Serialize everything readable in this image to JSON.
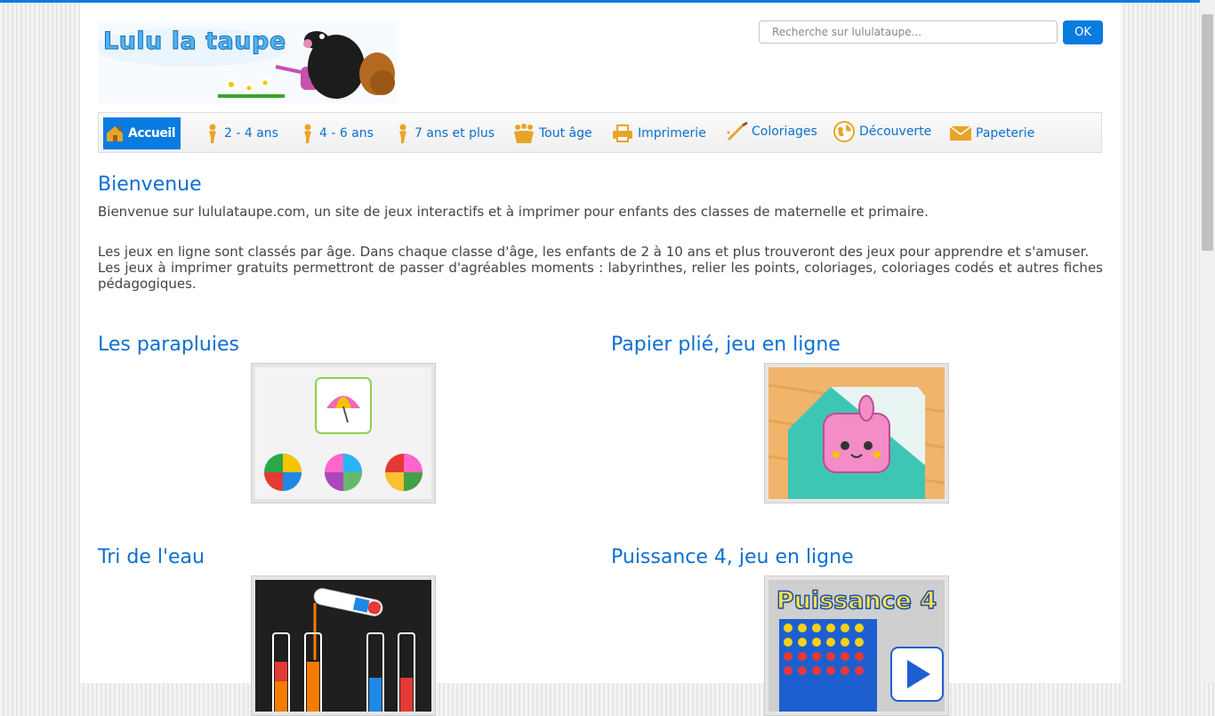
{
  "logo": {
    "text": "Lulu la taupe"
  },
  "search": {
    "placeholder": "Recherche sur lululataupe...",
    "button_label": "OK"
  },
  "nav": {
    "items": [
      {
        "label": "Accueil",
        "icon": "house-icon"
      },
      {
        "label": "2 - 4 ans",
        "icon": "child-icon"
      },
      {
        "label": "4 - 6 ans",
        "icon": "child-icon"
      },
      {
        "label": "7 ans et plus",
        "icon": "child-icon"
      },
      {
        "label": "Tout âge",
        "icon": "family-icon"
      },
      {
        "label": "Imprimerie",
        "icon": "printer-icon"
      },
      {
        "label": "Coloriages",
        "icon": "paintbrush-icon"
      },
      {
        "label": "Découverte",
        "icon": "globe-icon"
      },
      {
        "label": "Papeterie",
        "icon": "envelope-icon"
      }
    ]
  },
  "welcome": {
    "title": "Bienvenue",
    "intro": "Bienvenue sur lululataupe.com, un site de jeux interactifs et à imprimer pour enfants des classes de maternelle et primaire.",
    "para1": "Les jeux en ligne sont classés par âge. Dans chaque classe d'âge, les enfants de 2 à 10 ans et plus trouveront des jeux pour apprendre et s'amuser.",
    "para2": "Les jeux à imprimer gratuits permettront de passer d'agréables moments : labyrinthes, relier les points, coloriages, coloriages codés et autres fiches pédagogiques."
  },
  "games": [
    {
      "title": "Les parapluies"
    },
    {
      "title": "Papier plié, jeu en ligne"
    },
    {
      "title": "Tri de l'eau"
    },
    {
      "title": "Puissance 4, jeu en ligne",
      "image_text": "Puissance 4"
    }
  ],
  "colors": {
    "accent": "#0a7be0",
    "link": "#0d6fcf",
    "text": "#444444"
  }
}
